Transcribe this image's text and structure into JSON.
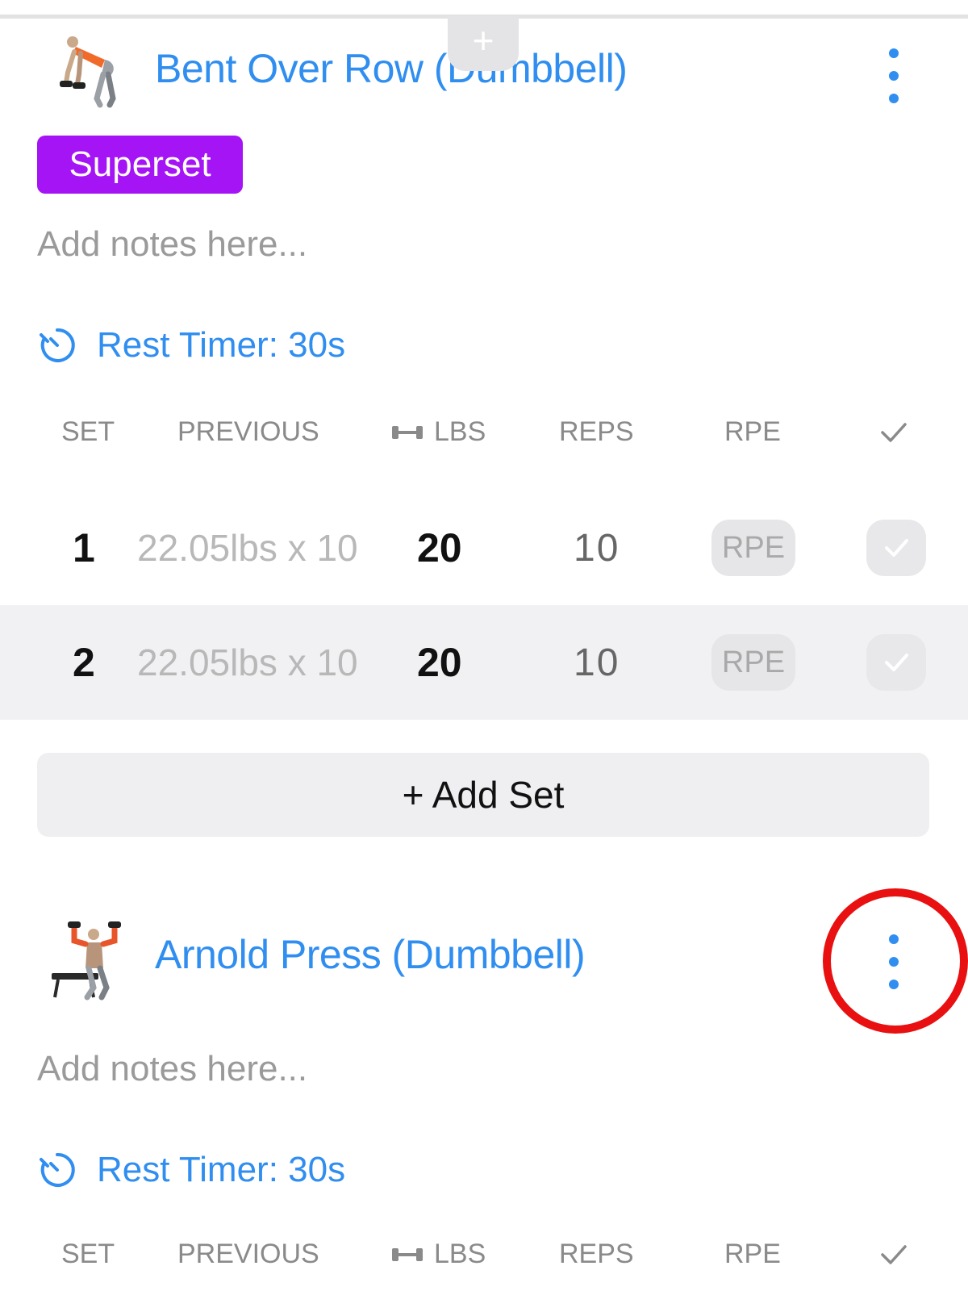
{
  "exercises": [
    {
      "name": "Bent Over Row (Dumbbell)",
      "badge": "Superset",
      "notes_placeholder": "Add notes here...",
      "rest_timer": "Rest Timer: 30s",
      "columns": {
        "set": "SET",
        "previous": "PREVIOUS",
        "lbs": "LBS",
        "reps": "REPS",
        "rpe": "RPE"
      },
      "sets": [
        {
          "num": "1",
          "previous": "22.05lbs x 10",
          "lbs": "20",
          "reps": "10",
          "rpe": "RPE"
        },
        {
          "num": "2",
          "previous": "22.05lbs x 10",
          "lbs": "20",
          "reps": "10",
          "rpe": "RPE"
        }
      ],
      "add_set_label": "+ Add Set"
    },
    {
      "name": "Arnold Press (Dumbbell)",
      "notes_placeholder": "Add notes here...",
      "rest_timer": "Rest Timer: 30s",
      "columns": {
        "set": "SET",
        "previous": "PREVIOUS",
        "lbs": "LBS",
        "reps": "REPS",
        "rpe": "RPE"
      }
    }
  ],
  "top_add_label": "+",
  "icons": {
    "menu": "vertical-ellipsis-icon",
    "timer": "stopwatch-icon",
    "weight": "dumbbell-icon",
    "check": "checkmark-icon"
  },
  "colors": {
    "accent": "#2f8ef0",
    "superset": "#a514f5",
    "highlight_ring": "#e81010"
  }
}
